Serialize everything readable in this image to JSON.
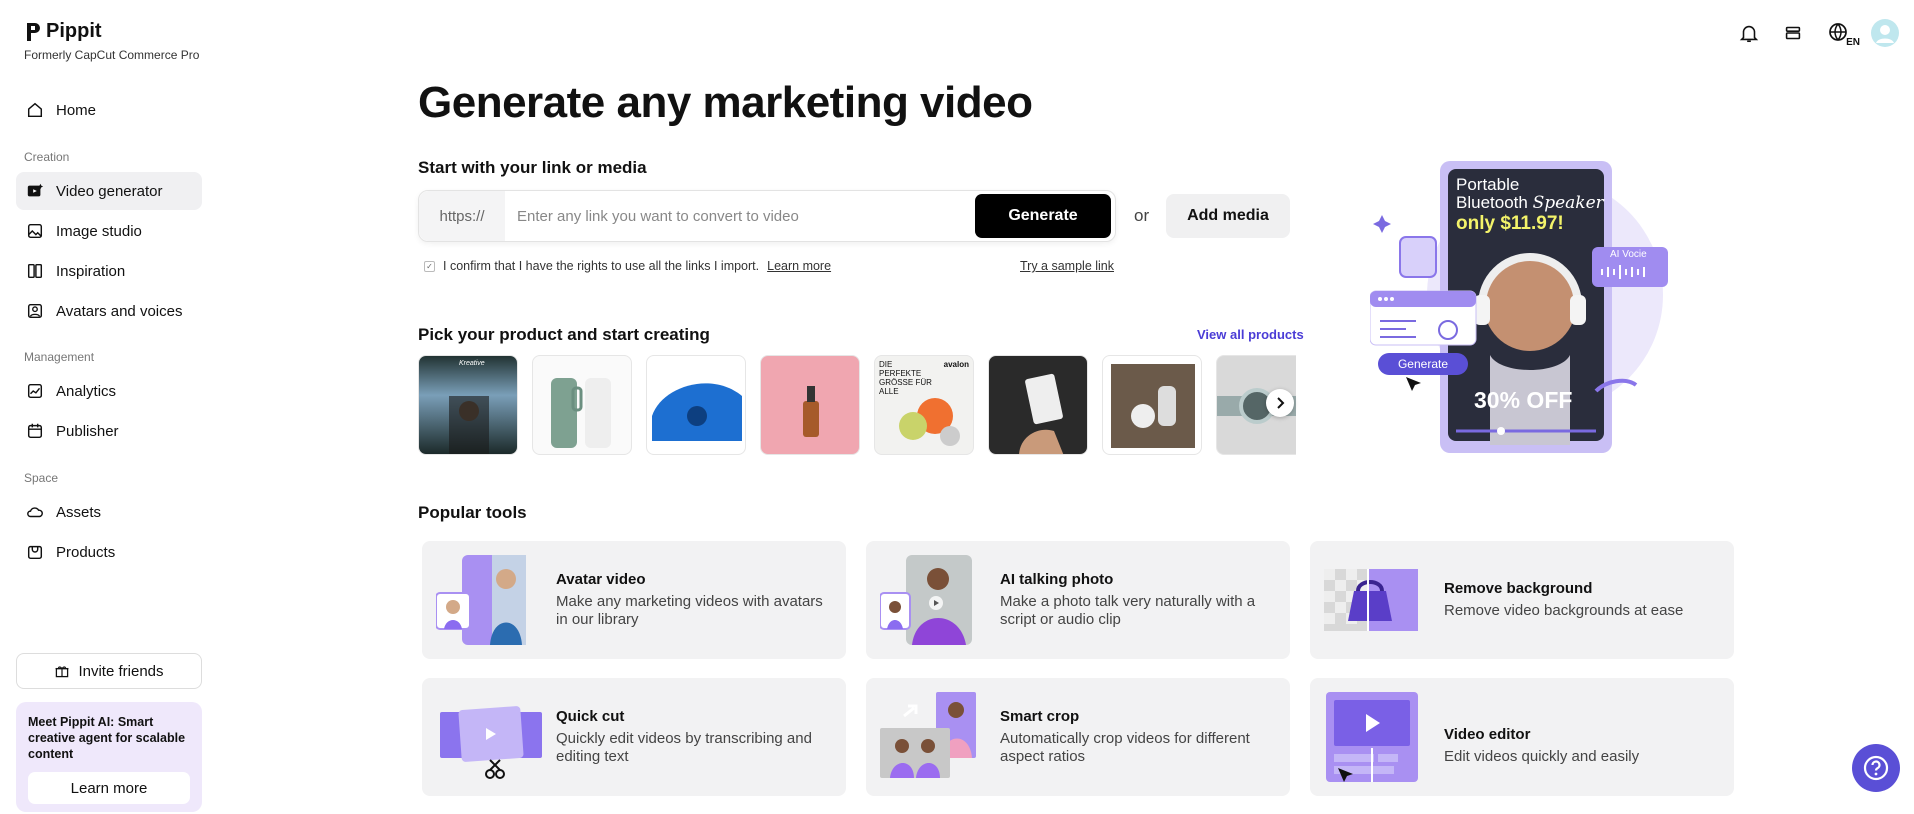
{
  "brand": {
    "name": "Pippit",
    "subtitle": "Formerly CapCut Commerce Pro"
  },
  "sidebar": {
    "home": "Home",
    "section_creation": "Creation",
    "creation_items": [
      "Video generator",
      "Image studio",
      "Inspiration",
      "Avatars and voices"
    ],
    "section_management": "Management",
    "management_items": [
      "Analytics",
      "Publisher"
    ],
    "section_space": "Space",
    "space_items": [
      "Assets",
      "Products"
    ],
    "invite": "Invite friends",
    "promo_text": "Meet Pippit AI: Smart creative agent for scalable content",
    "promo_button": "Learn more"
  },
  "header": {
    "language": "EN"
  },
  "main": {
    "title": "Generate any marketing video",
    "start_label": "Start with your link or media",
    "url_prefix": "https://",
    "url_placeholder": "Enter any link you want to convert to video",
    "generate": "Generate",
    "or": "or",
    "add_media": "Add media",
    "confirm_text": "I confirm that I have the rights to use all the links I import.",
    "learn_more": "Learn more",
    "sample_link": "Try a sample link",
    "pick_label": "Pick your product and start creating",
    "view_all": "View all products",
    "products": [
      {
        "thumb_text": "Kreative"
      },
      {
        "thumb_text": ""
      },
      {
        "thumb_text": ""
      },
      {
        "thumb_text": ""
      },
      {
        "thumb_text": "DIE PERFEKTE GRÖSSE FÜR ALLE",
        "brand": "avalon"
      },
      {
        "thumb_text": ""
      },
      {
        "thumb_text": ""
      },
      {
        "thumb_text": ""
      }
    ],
    "popular_label": "Popular tools"
  },
  "hero": {
    "line1": "Portable",
    "line2": "Bluetooth",
    "line2b": "Speaker",
    "price": "only $11.97!",
    "offer": "30% OFF",
    "ai_voice": "AI Vocie",
    "generate": "Generate"
  },
  "tools": [
    {
      "title": "Avatar video",
      "desc": "Make any marketing videos with avatars in our library"
    },
    {
      "title": "AI talking photo",
      "desc": "Make a photo talk very naturally with a script or audio clip"
    },
    {
      "title": "Remove background",
      "desc": "Remove video backgrounds at ease"
    },
    {
      "title": "Quick cut",
      "desc": "Quickly edit videos by transcribing and editing text"
    },
    {
      "title": "Smart crop",
      "desc": "Automatically crop videos for different aspect ratios"
    },
    {
      "title": "Video editor",
      "desc": "Edit videos quickly and easily"
    }
  ],
  "colors": {
    "accent": "#5a4fd6",
    "purple_light": "#efe8fb",
    "link": "#4a3cd6"
  }
}
